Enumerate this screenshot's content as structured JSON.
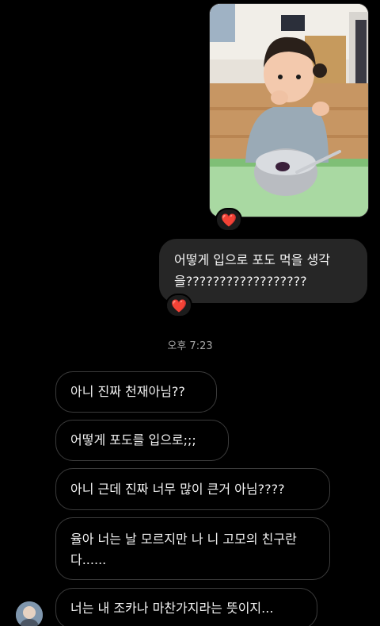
{
  "thread": {
    "photo_message": {
      "reaction": "❤️"
    },
    "outgoing_message": {
      "text": "어떻게 입으로 포도 먹을 생각을??????????????????",
      "reaction": "❤️"
    },
    "timestamp": "오후 7:23",
    "incoming_messages": [
      {
        "text": "아니 진짜 천재아님??"
      },
      {
        "text": "어떻게 포도를 입으로;;;"
      },
      {
        "text": "아니 근데 진짜 너무 많이 큰거 아님????"
      },
      {
        "text": "율아 너는 날 모르지만 나 니 고모의 친구란다......"
      },
      {
        "text": "너는 내 조카나 마찬가지라는 뜻이지..."
      }
    ]
  },
  "icons": {
    "reaction_icon": "red-heart-icon",
    "sender_avatar": "avatar"
  },
  "colors": {
    "background": "#000000",
    "outgoing_bubble": "#262626",
    "incoming_bubble_border": "#3b3b3b",
    "heart": "#ff2d3a"
  }
}
